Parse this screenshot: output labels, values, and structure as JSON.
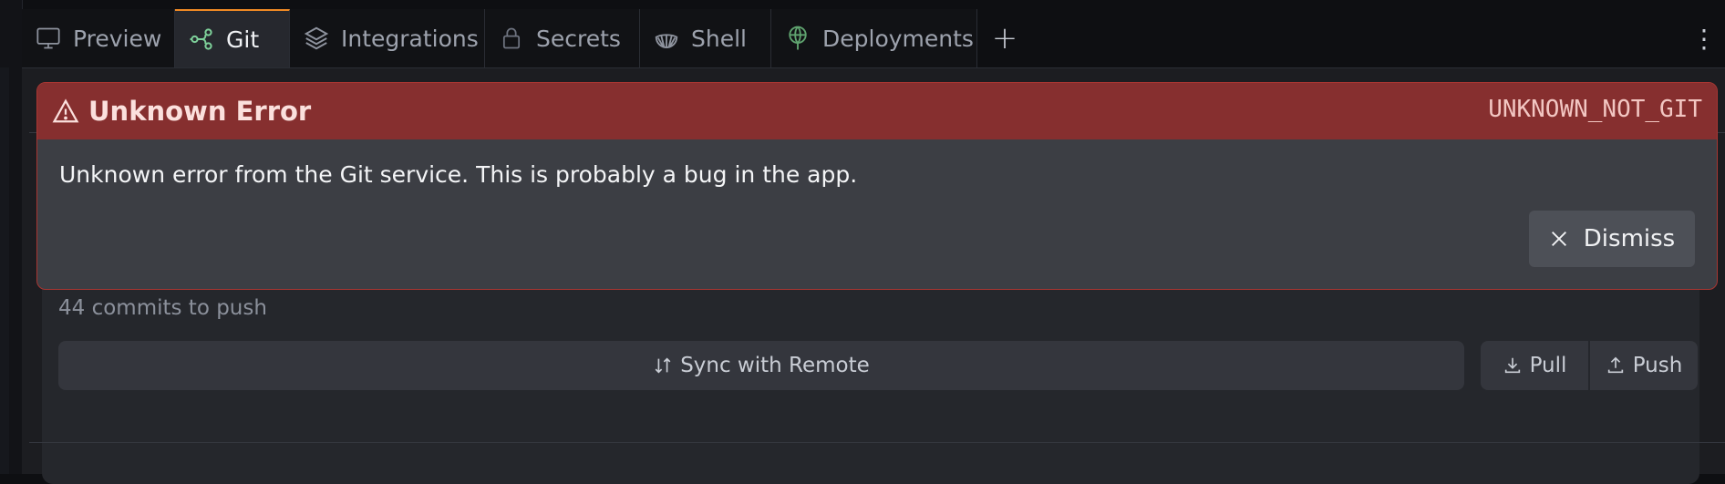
{
  "tabs": [
    {
      "label": "Preview",
      "icon": "monitor-icon"
    },
    {
      "label": "Git",
      "icon": "git-branch-icon",
      "active": true
    },
    {
      "label": "Integrations",
      "icon": "layers-icon"
    },
    {
      "label": "Secrets",
      "icon": "lock-icon"
    },
    {
      "label": "Shell",
      "icon": "shell-icon"
    },
    {
      "label": "Deployments",
      "icon": "deployments-icon"
    }
  ],
  "tab_actions": {
    "add_label": "+",
    "menu_label": "⋮"
  },
  "error": {
    "title": "Unknown Error",
    "code": "UNKNOWN_NOT_GIT",
    "message": "Unknown error from the Git service. This is probably a bug in the app.",
    "dismiss_label": "Dismiss"
  },
  "git": {
    "commits_status": "44 commits to push",
    "sync_label": "Sync with Remote",
    "pull_label": "Pull",
    "push_label": "Push"
  },
  "colors": {
    "accent_tab": "#f08a24",
    "error_header": "#862f2f",
    "error_border": "#a93632",
    "git_icon": "#7ed19a",
    "deploy_icon": "#5fa36f"
  }
}
